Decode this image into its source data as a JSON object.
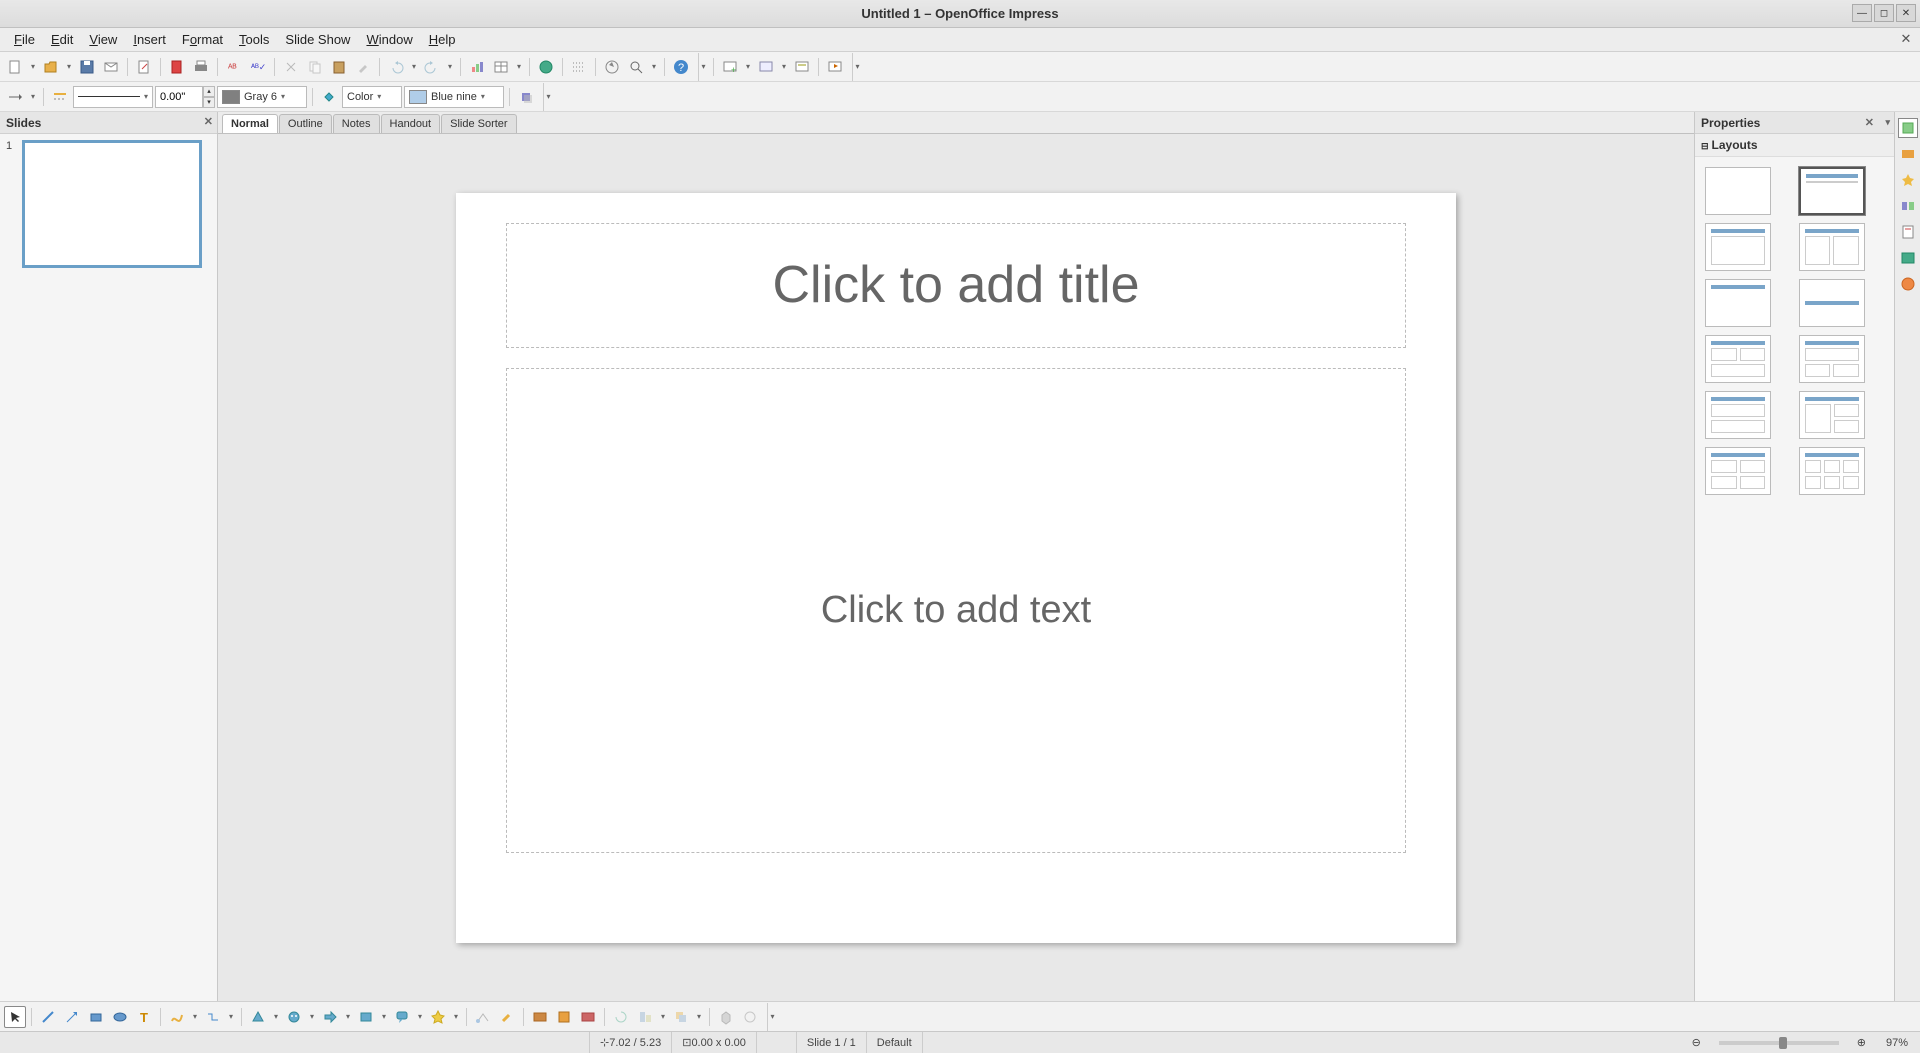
{
  "window": {
    "title": "Untitled 1 – OpenOffice Impress"
  },
  "menu": {
    "file": "File",
    "edit": "Edit",
    "view": "View",
    "insert": "Insert",
    "format": "Format",
    "tools": "Tools",
    "slideshow": "Slide Show",
    "window": "Window",
    "help": "Help"
  },
  "toolbar2": {
    "line_width": "0.00\"",
    "line_color_name": "Gray 6",
    "line_color_hex": "#808080",
    "fill_type": "Color",
    "fill_color_name": "Blue nine",
    "fill_color_hex": "#b0cde8"
  },
  "slides_panel": {
    "title": "Slides",
    "items": [
      {
        "num": "1"
      }
    ]
  },
  "view_tabs": {
    "normal": "Normal",
    "outline": "Outline",
    "notes": "Notes",
    "handout": "Handout",
    "sorter": "Slide Sorter"
  },
  "canvas": {
    "title_placeholder": "Click to add title",
    "body_placeholder": "Click to add text"
  },
  "properties": {
    "title": "Properties",
    "layouts_label": "Layouts"
  },
  "status": {
    "cursor": "7.02 / 5.23",
    "size": "0.00 x 0.00",
    "slide": "Slide 1 / 1",
    "master": "Default",
    "zoom": "97%"
  }
}
